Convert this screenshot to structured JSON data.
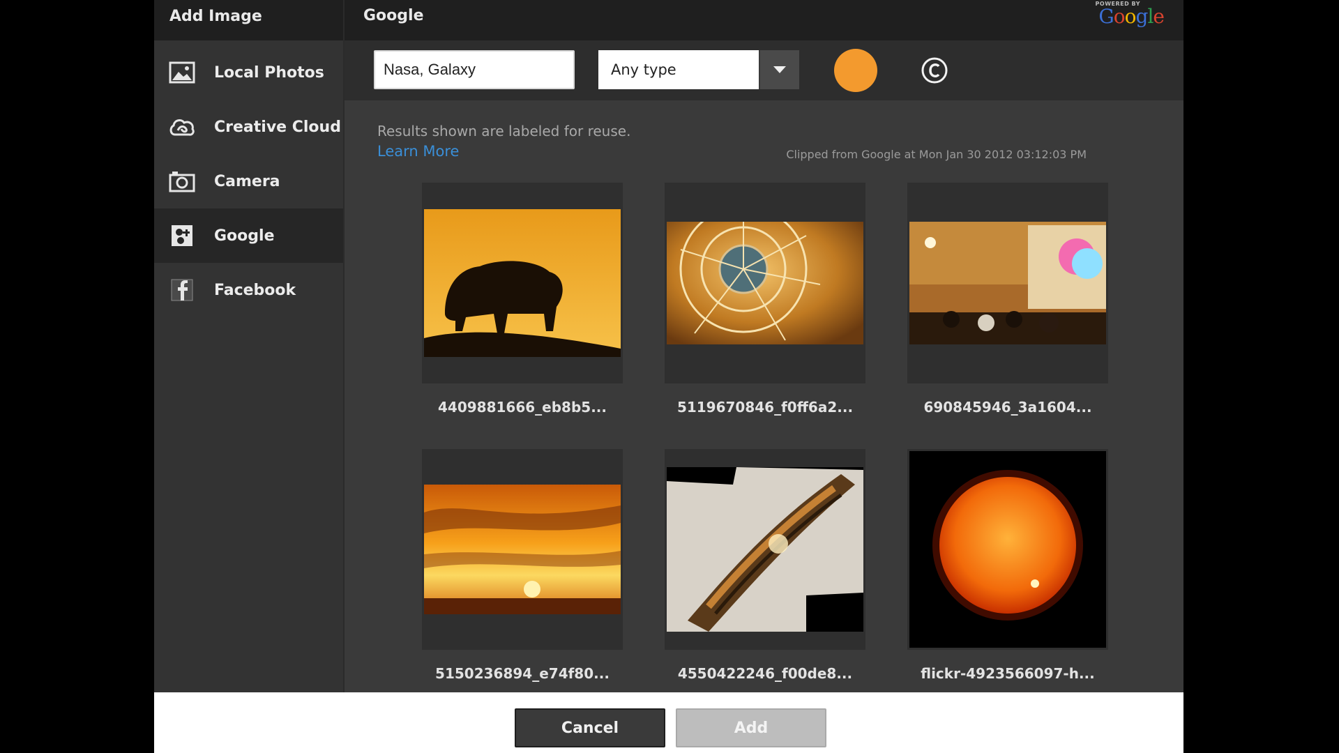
{
  "sidebar": {
    "title": "Add Image",
    "items": [
      {
        "label": "Local Photos",
        "icon": "image-icon"
      },
      {
        "label": "Creative Cloud",
        "icon": "creative-cloud-icon"
      },
      {
        "label": "Camera",
        "icon": "camera-icon"
      },
      {
        "label": "Google",
        "icon": "google-icon",
        "active": true
      },
      {
        "label": "Facebook",
        "icon": "facebook-icon"
      }
    ]
  },
  "main": {
    "title": "Google",
    "powered_by": "POWERED BY",
    "powered_brand": "Google"
  },
  "toolbar": {
    "search_value": "Nasa, Galaxy",
    "type_value": "Any type",
    "color_filter": "#f39a2e"
  },
  "results": {
    "notice": "Results shown are labeled for reuse.",
    "learn_more": "Learn More",
    "clipped": "Clipped from Google at Mon Jan 30 2012 03:12:03 PM",
    "items": [
      {
        "name": "4409881666_eb8b5..."
      },
      {
        "name": "5119670846_f0ff6a2..."
      },
      {
        "name": "690845946_3a1604..."
      },
      {
        "name": "5150236894_e74f80..."
      },
      {
        "name": "4550422246_f00de8..."
      },
      {
        "name": "flickr-4923566097-h..."
      }
    ]
  },
  "footer": {
    "cancel_label": "Cancel",
    "add_label": "Add"
  }
}
